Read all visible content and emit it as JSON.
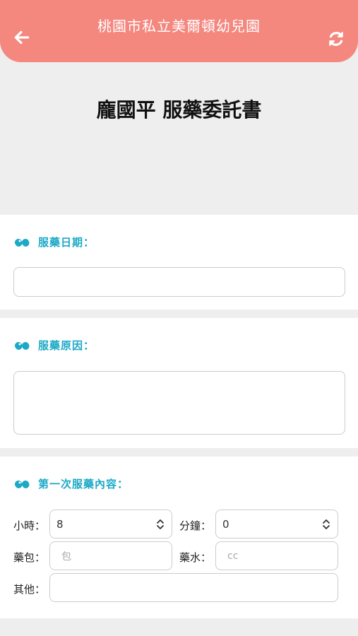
{
  "header": {
    "title": "桃園市私立美爾頓幼兒園",
    "back_icon": "arrow-left-icon",
    "refresh_icon": "refresh-icon",
    "color": "#f4877e"
  },
  "document_title": "龐國平 服藥委託書",
  "accent_color": "#1ba9c6",
  "sections": {
    "date": {
      "icon": "pills-icon",
      "label": "服藥日期：",
      "value": ""
    },
    "reason": {
      "icon": "pills-icon",
      "label": "服藥原因：",
      "value": ""
    },
    "first_dose": {
      "icon": "pills-icon",
      "label": "第一次服藥內容：",
      "hour_label": "小時：",
      "hour_value": "8",
      "minute_label": "分鐘：",
      "minute_value": "0",
      "packet_label": "藥包：",
      "packet_placeholder": "包",
      "liquid_label": "藥水：",
      "liquid_placeholder": "cc",
      "other_label": "其他：",
      "other_value": ""
    }
  }
}
